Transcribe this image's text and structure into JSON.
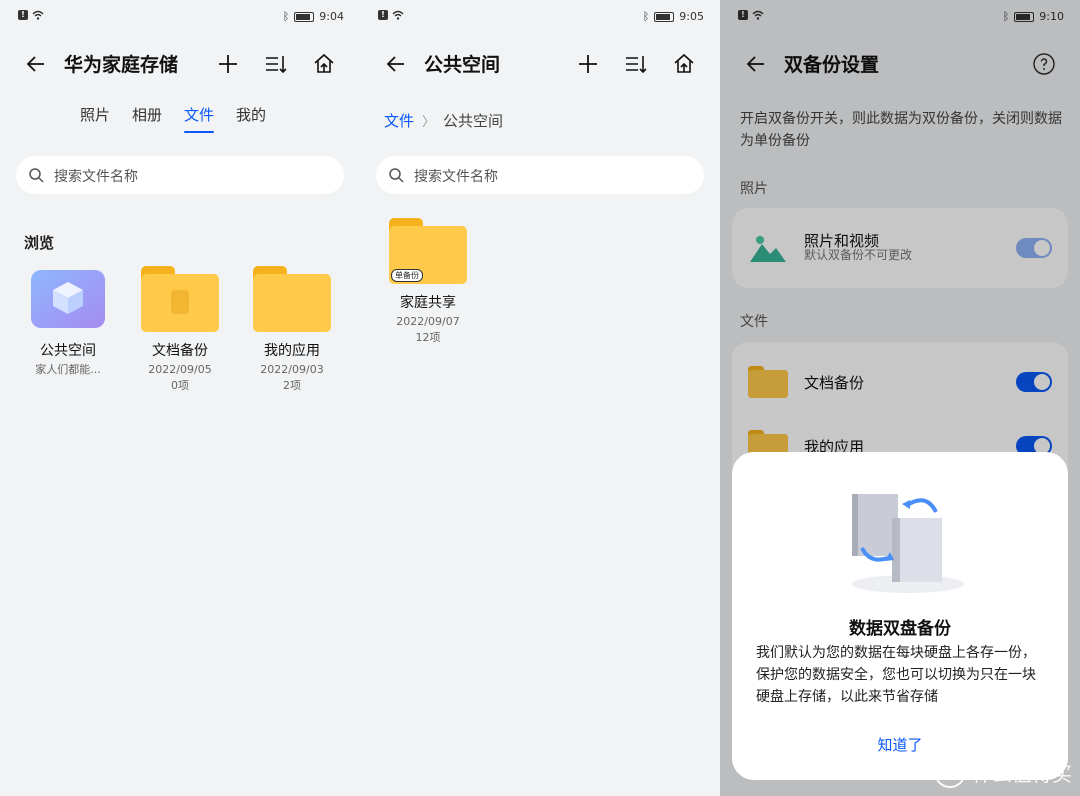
{
  "screen1": {
    "time": "9:04",
    "title": "华为家庭存储",
    "tabs": [
      {
        "label": "照片"
      },
      {
        "label": "相册"
      },
      {
        "label": "文件"
      },
      {
        "label": "我的"
      }
    ],
    "active_tab": "文件",
    "search_placeholder": "搜索文件名称",
    "section_title": "浏览",
    "items": [
      {
        "name": "公共空间",
        "sub1": "家人们都能...",
        "sub2": ""
      },
      {
        "name": "文档备份",
        "sub1": "2022/09/05",
        "sub2": "0项"
      },
      {
        "name": "我的应用",
        "sub1": "2022/09/03",
        "sub2": "2项"
      }
    ]
  },
  "screen2": {
    "time": "9:05",
    "title": "公共空间",
    "breadcrumb": [
      "文件",
      "公共空间"
    ],
    "search_placeholder": "搜索文件名称",
    "item": {
      "name": "家庭共享",
      "date": "2022/09/07",
      "count": "12项",
      "badge": "单备份"
    }
  },
  "screen3": {
    "time": "9:10",
    "title": "双备份设置",
    "description": "开启双备份开关，则此数据为双份备份，关闭则数据为单份备份",
    "group_photos": "照片",
    "photo_row": {
      "label": "照片和视频",
      "sublabel": "默认双备份不可更改"
    },
    "group_files": "文件",
    "file_rows": [
      {
        "label": "文档备份"
      },
      {
        "label": "我的应用"
      }
    ],
    "dialog": {
      "title": "数据双盘备份",
      "body": "我们默认为您的数据在每块硬盘上各存一份，保护您的数据安全，您也可以切换为只在一块硬盘上存储，以此来节省存储",
      "button": "知道了"
    },
    "watermark": "什么值得买",
    "watermark_icon": "值"
  },
  "colors": {
    "accent": "#0a59f7",
    "folder": "#ffc94a",
    "background": "#f1f3f5"
  }
}
